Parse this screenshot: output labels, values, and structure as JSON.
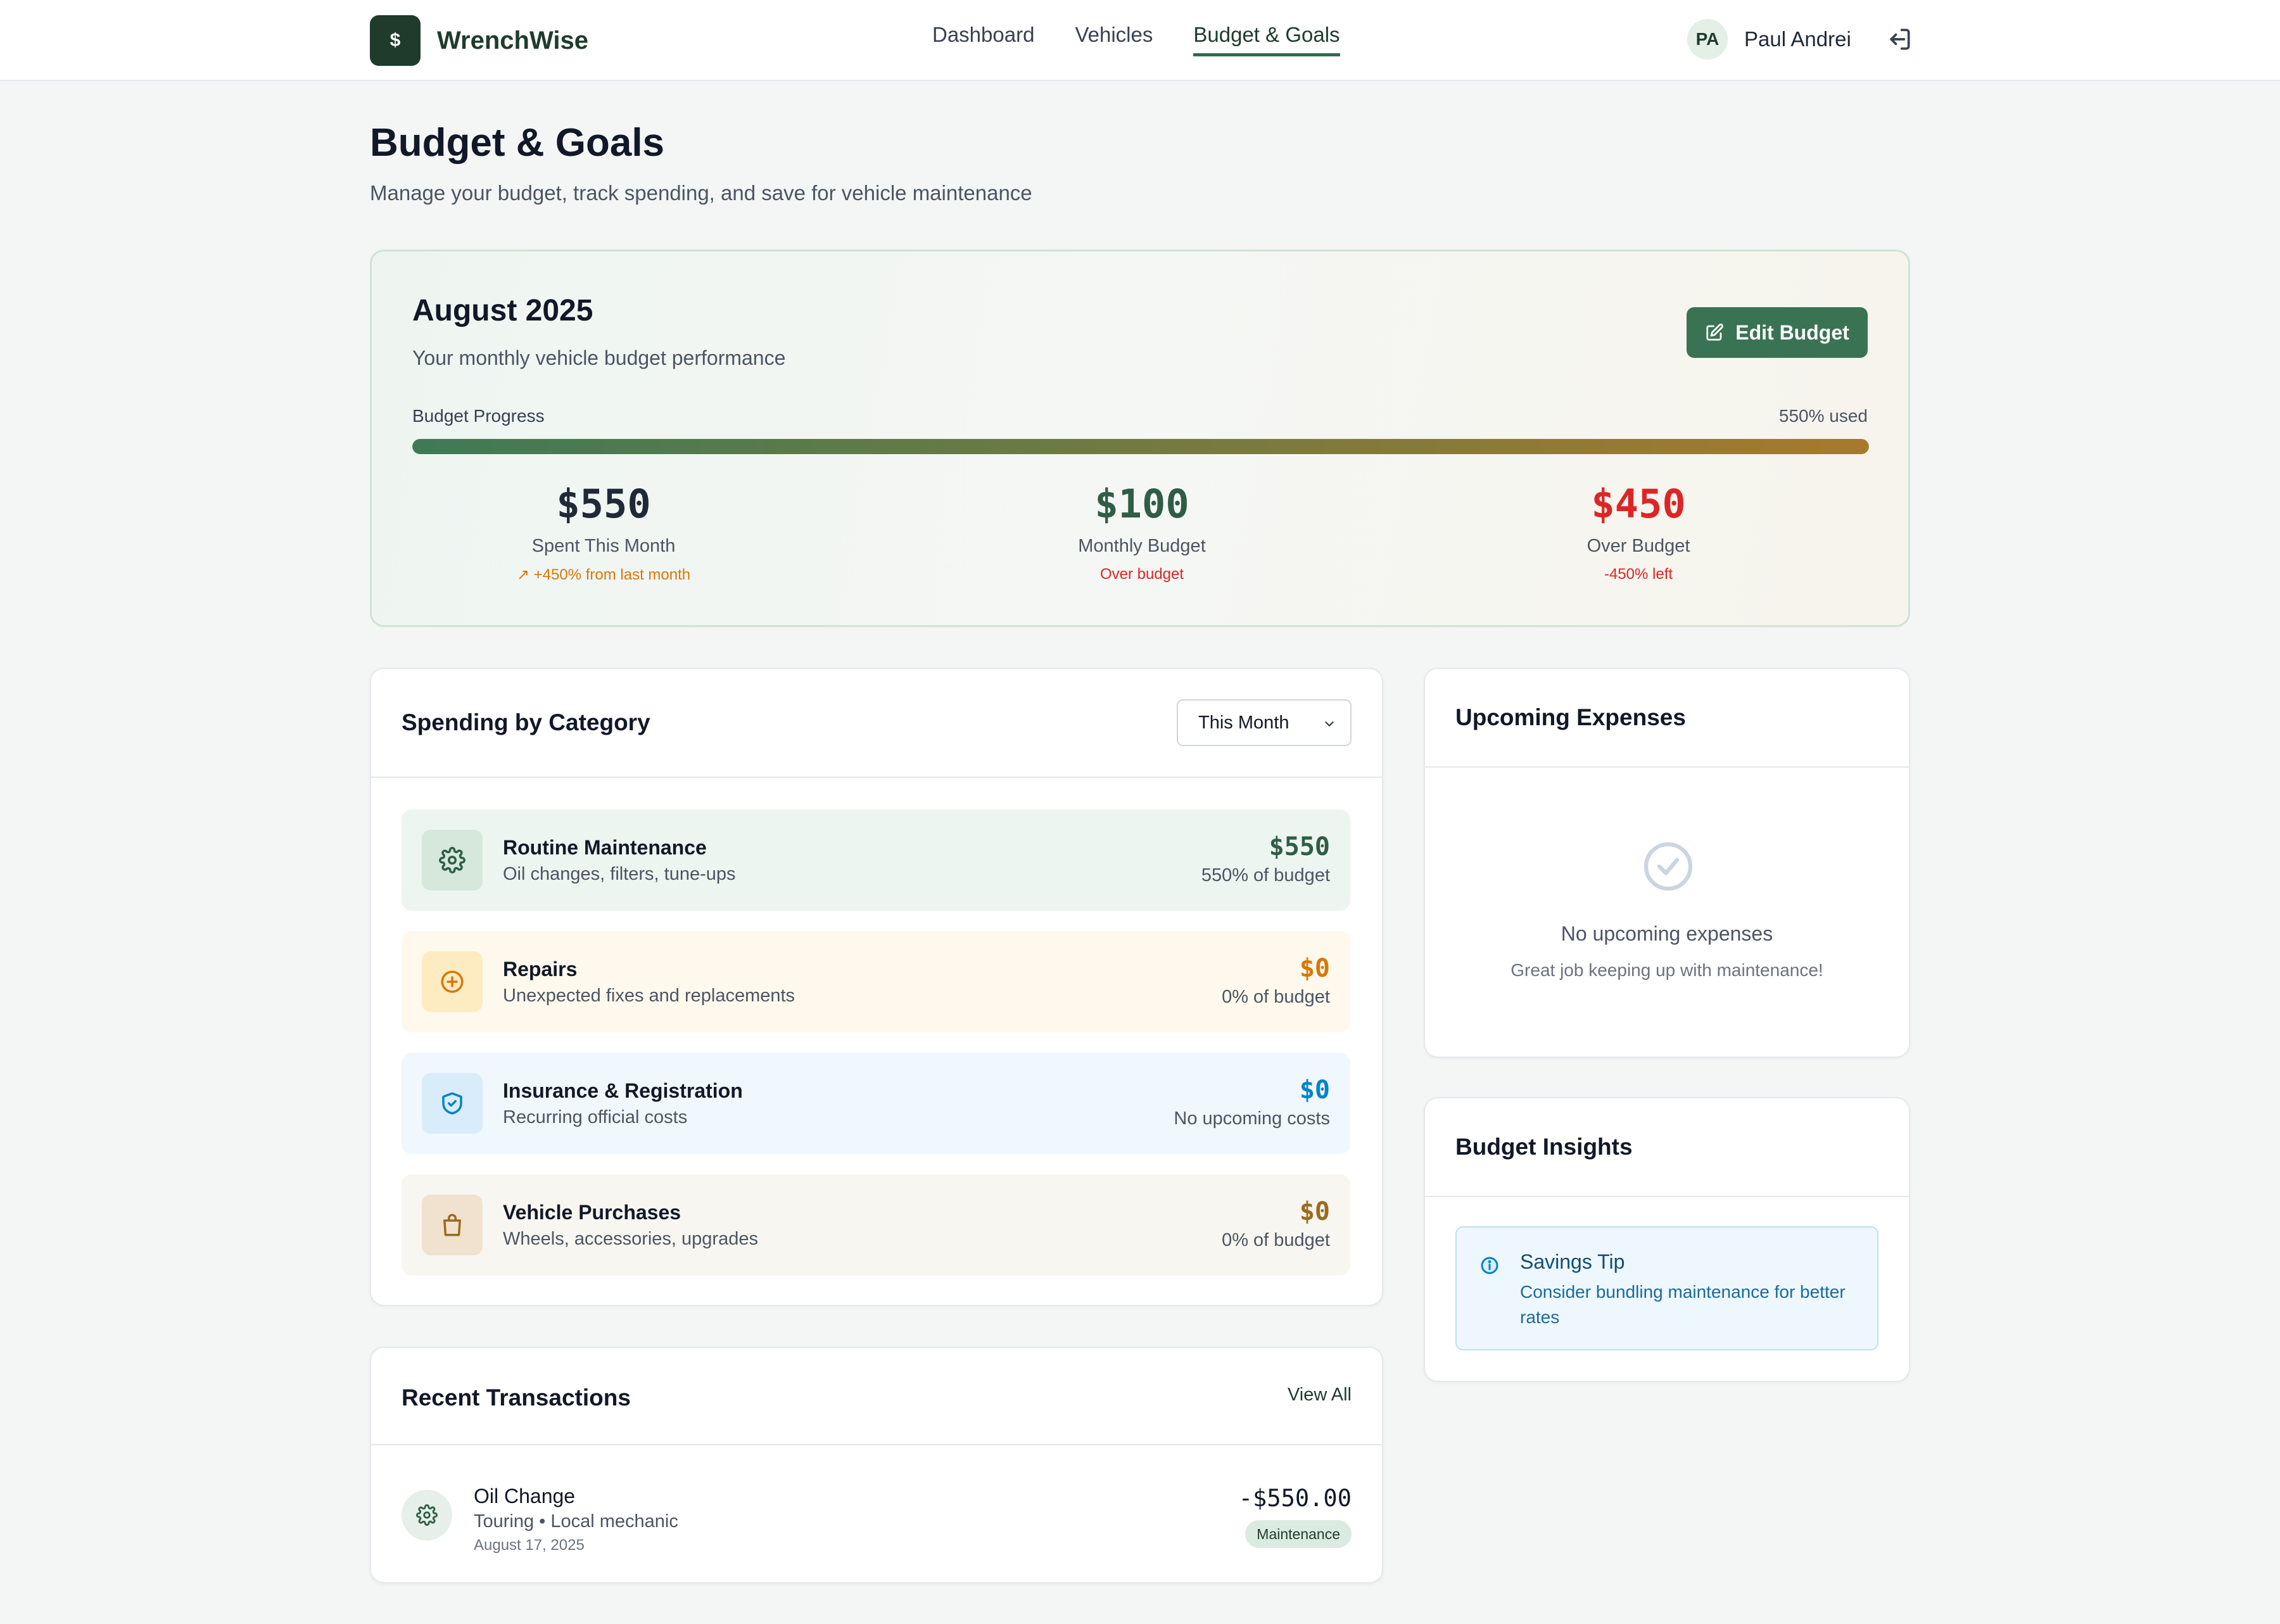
{
  "app": {
    "name": "WrenchWise",
    "logo_glyph": "$"
  },
  "nav": {
    "links": [
      "Dashboard",
      "Vehicles",
      "Budget & Goals"
    ],
    "active": "Budget & Goals",
    "user_initials": "PA",
    "user_name": "Paul Andrei"
  },
  "header": {
    "title": "Budget & Goals",
    "subtitle": "Manage your budget, track spending, and save for vehicle maintenance"
  },
  "budget": {
    "month": "August 2025",
    "subtitle": "Your monthly vehicle budget performance",
    "edit_label": "Edit Budget",
    "progress_label": "Budget Progress",
    "progress_used": "550% used",
    "progress_fraction": 1.0,
    "stats": [
      {
        "value": "$550",
        "label": "Spent This Month",
        "note": "↗ +450% from last month",
        "value_color": "#1f2937",
        "note_color": "#d97706"
      },
      {
        "value": "$100",
        "label": "Monthly Budget",
        "note": "Over budget",
        "value_color": "#2f5d45",
        "note_color": "#dc2626"
      },
      {
        "value": "$450",
        "label": "Over Budget",
        "note": "-450% left",
        "value_color": "#dc2626",
        "note_color": "#dc2626"
      }
    ]
  },
  "spending": {
    "title": "Spending by Category",
    "period_selected": "This Month",
    "categories": [
      {
        "name": "Routine Maintenance",
        "desc": "Oil changes, filters, tune-ups",
        "amount": "$550",
        "pct": "550% of budget",
        "icon": "gear-icon",
        "bg": "#edf5f0",
        "icon_bg": "#d6e8dc",
        "color": "#2f5d45"
      },
      {
        "name": "Repairs",
        "desc": "Unexpected fixes and replacements",
        "amount": "$0",
        "pct": "0% of budget",
        "icon": "plus-circle-icon",
        "bg": "#fef9ec",
        "icon_bg": "#fdecc2",
        "color": "#d97706"
      },
      {
        "name": "Insurance & Registration",
        "desc": "Recurring official costs",
        "amount": "$0",
        "pct": "No upcoming costs",
        "icon": "shield-check-icon",
        "bg": "#f0f7fd",
        "icon_bg": "#d9ecfa",
        "color": "#0284c7"
      },
      {
        "name": "Vehicle Purchases",
        "desc": "Wheels, accessories, upgrades",
        "amount": "$0",
        "pct": "0% of budget",
        "icon": "shopping-bag-icon",
        "bg": "#f8f6f0",
        "icon_bg": "#f1e2cf",
        "color": "#9a6b1f"
      }
    ]
  },
  "transactions": {
    "title": "Recent Transactions",
    "view_all": "View All",
    "items": [
      {
        "name": "Oil Change",
        "meta": "Touring • Local mechanic",
        "date": "August 17, 2025",
        "amount": "-$550.00",
        "badge": "Maintenance",
        "icon": "gear-icon"
      }
    ]
  },
  "upcoming": {
    "title": "Upcoming Expenses",
    "empty_title": "No upcoming expenses",
    "empty_sub": "Great job keeping up with maintenance!"
  },
  "insights": {
    "title": "Budget Insights",
    "tip_title": "Savings Tip",
    "tip_text": "Consider bundling maintenance for better rates"
  }
}
